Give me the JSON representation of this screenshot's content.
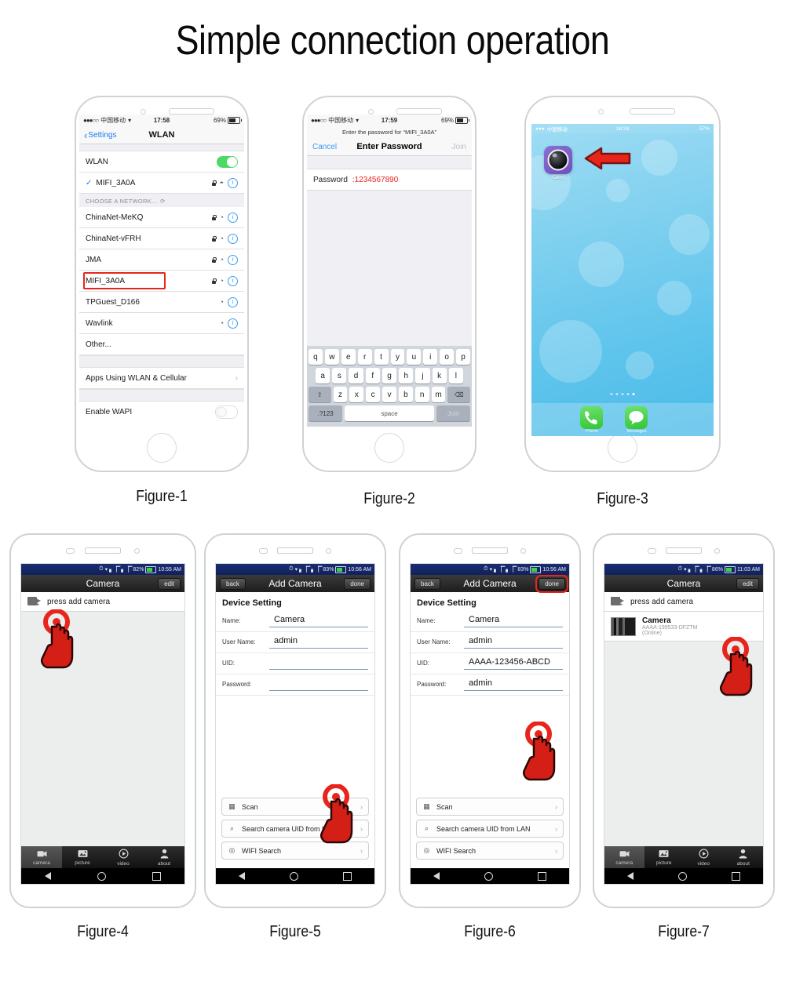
{
  "page": {
    "title": "Simple connection operation"
  },
  "figures": [
    {
      "caption": "Figure-1"
    },
    {
      "caption": "Figure-2"
    },
    {
      "caption": "Figure-3"
    },
    {
      "caption": "Figure-4"
    },
    {
      "caption": "Figure-5"
    },
    {
      "caption": "Figure-6"
    },
    {
      "caption": "Figure-7"
    }
  ],
  "colors": {
    "accent_red": "#e8251c",
    "ios_blue": "#1d7cf2",
    "android_status": "#11215c",
    "toggle_green": "#4cd964"
  },
  "fig1": {
    "status": {
      "dots": "●●●○○",
      "carrier": "中国移动",
      "wifi": "▾",
      "time": "17:58",
      "battery": "69%"
    },
    "nav": {
      "back": "Settings",
      "title": "WLAN"
    },
    "wlan_toggle_label": "WLAN",
    "connected_network": "MIFI_3A0A",
    "group_header": "CHOOSE A NETWORK...",
    "networks": [
      {
        "name": "ChinaNet-MeKQ",
        "locked": true,
        "highlight": false
      },
      {
        "name": "ChinaNet-vFRH",
        "locked": true,
        "highlight": false
      },
      {
        "name": "JMA",
        "locked": true,
        "highlight": false
      },
      {
        "name": "MIFI_3A0A",
        "locked": true,
        "highlight": true
      },
      {
        "name": "TPGuest_D166",
        "locked": false,
        "highlight": false
      },
      {
        "name": "Wavlink",
        "locked": false,
        "highlight": false
      },
      {
        "name": "Other...",
        "locked": false,
        "highlight": false,
        "plain": true
      }
    ],
    "apps_row": "Apps Using WLAN & Cellular",
    "wapi_row": "Enable WAPI"
  },
  "fig2": {
    "status": {
      "dots": "●●●○○",
      "carrier": "中国移动",
      "wifi": "▾",
      "time": "17:59",
      "battery": "69%"
    },
    "subtitle": "Enter the password for “MIFI_3A0A”",
    "cancel": "Cancel",
    "title": "Enter Password",
    "join": "Join",
    "password_label": "Password",
    "password_value": ":1234567890",
    "keyboard": {
      "row1": [
        "q",
        "w",
        "e",
        "r",
        "t",
        "y",
        "u",
        "i",
        "o",
        "p"
      ],
      "row2": [
        "a",
        "s",
        "d",
        "f",
        "g",
        "h",
        "j",
        "k",
        "l"
      ],
      "row3": [
        "z",
        "x",
        "c",
        "v",
        "b",
        "n",
        "m"
      ],
      "shift": "⇧",
      "backspace": "⌫",
      "numeric": ".?123",
      "space": "space",
      "join": "Join"
    }
  },
  "fig3": {
    "status": {
      "dots": "●●●",
      "carrier": "中国移动",
      "time": "18:28",
      "battery": "57%"
    },
    "app_label": "Camr",
    "dock": [
      {
        "label": "Phone",
        "icon": "phone-icon"
      },
      {
        "label": "Messages",
        "icon": "messages-icon"
      }
    ],
    "arrow": "left-arrow-annotation"
  },
  "fig4": {
    "status": {
      "signal": "▮▮▮",
      "battery": "82%",
      "time": "10:55 AM"
    },
    "title": "Camera",
    "edit": "edit",
    "add_row": "press add camera",
    "tabs": [
      {
        "label": "camera",
        "icon": "camera-icon",
        "active": true
      },
      {
        "label": "picture",
        "icon": "picture-icon",
        "active": false
      },
      {
        "label": "video",
        "icon": "video-icon",
        "active": false
      },
      {
        "label": "about",
        "icon": "person-icon",
        "active": false
      }
    ]
  },
  "fig5": {
    "status": {
      "battery": "83%",
      "time": "10:56 AM"
    },
    "back": "back",
    "title": "Add Camera",
    "done": "done",
    "section": "Device Setting",
    "fields": [
      {
        "label": "Name:",
        "value": "Camera"
      },
      {
        "label": "User Name:",
        "value": "admin"
      },
      {
        "label": "UID:",
        "value": ""
      },
      {
        "label": "Password:",
        "value": ""
      }
    ],
    "actions": [
      {
        "label": "Scan",
        "icon": "qr-scan-icon"
      },
      {
        "label": "Search camera UID from LAN",
        "icon": "search-icon"
      },
      {
        "label": "WIFI Search",
        "icon": "wifi-icon"
      }
    ]
  },
  "fig6": {
    "status": {
      "battery": "83%",
      "time": "10:56 AM"
    },
    "back": "back",
    "title": "Add Camera",
    "done": "done",
    "section": "Device Setting",
    "fields": [
      {
        "label": "Name:",
        "value": "Camera"
      },
      {
        "label": "User Name:",
        "value": "admin"
      },
      {
        "label": "UID:",
        "value": "AAAA-123456-ABCD"
      },
      {
        "label": "Password:",
        "value": "admin"
      }
    ],
    "actions": [
      {
        "label": "Scan",
        "icon": "qr-scan-icon"
      },
      {
        "label": "Search camera UID from LAN",
        "icon": "search-icon"
      },
      {
        "label": "WIFI Search",
        "icon": "wifi-icon"
      }
    ]
  },
  "fig7": {
    "status": {
      "battery": "86%",
      "time": "11:03 AM"
    },
    "title": "Camera",
    "edit": "edit",
    "add_row": "press add camera",
    "camera": {
      "name": "Camera",
      "uid": "AAAA-199533-DFZTM",
      "state": "(Online)"
    },
    "tabs": [
      {
        "label": "camera",
        "icon": "camera-icon",
        "active": true
      },
      {
        "label": "picture",
        "icon": "picture-icon",
        "active": false
      },
      {
        "label": "video",
        "icon": "video-icon",
        "active": false
      },
      {
        "label": "about",
        "icon": "person-icon",
        "active": false
      }
    ]
  }
}
